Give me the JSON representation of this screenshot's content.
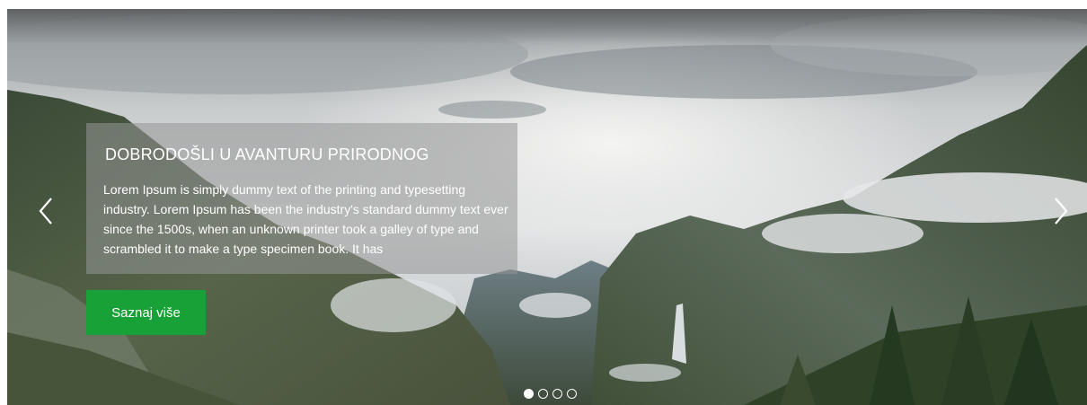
{
  "slider": {
    "slide": {
      "title": "DOBRODOŠLI U AVANTURU PRIRODNOG",
      "text": "Lorem Ipsum is simply dummy text of the printing and typesetting industry. Lorem Ipsum has been the industry's standard dummy text ever since the 1500s, when an unknown printer took a galley of type and scrambled it to make a type specimen book. It has",
      "button_label": "Saznaj više"
    },
    "controls": {
      "prev_icon": "chevron-left-icon",
      "next_icon": "chevron-right-icon"
    },
    "indicators": {
      "count": 4,
      "active_index": 0
    },
    "colors": {
      "button_bg": "#18a136",
      "caption_bg": "rgba(150,150,150,0.55)",
      "text": "#ffffff"
    }
  }
}
